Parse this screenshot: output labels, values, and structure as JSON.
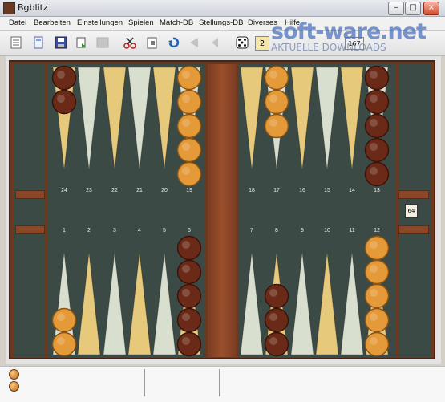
{
  "window": {
    "title": "Bgblitz"
  },
  "menu": [
    "Datei",
    "Bearbeiten",
    "Einstellungen",
    "Spielen",
    "Match-DB",
    "Stellungs-DB",
    "Diverses",
    "Hilfe"
  ],
  "toolbar": {
    "score_label": "2",
    "counter_label": "167"
  },
  "watermark": {
    "brand": "soft-ware.net",
    "tagline": "AKTUELLE DOWNLOADS"
  },
  "board": {
    "top_points": [
      "24",
      "23",
      "22",
      "21",
      "20",
      "19",
      "18",
      "17",
      "16",
      "15",
      "14",
      "13"
    ],
    "bottom_points": [
      "1",
      "2",
      "3",
      "4",
      "5",
      "6",
      "7",
      "8",
      "9",
      "10",
      "11",
      "12"
    ],
    "doubling_cube": "64",
    "colors": {
      "felt": "#3b4a45",
      "frame": "#6b3820",
      "light_point": "#d8dfcf",
      "gold_point": "#e7c97c",
      "dark_checker": "#6a2a17",
      "light_checker": "#e59a3a"
    },
    "checkers": [
      {
        "point": 24,
        "color": "dark",
        "count": 2
      },
      {
        "point": 19,
        "color": "light",
        "count": 5
      },
      {
        "point": 17,
        "color": "light",
        "count": 3
      },
      {
        "point": 13,
        "color": "dark",
        "count": 5
      },
      {
        "point": 1,
        "color": "light",
        "count": 2
      },
      {
        "point": 6,
        "color": "dark",
        "count": 5
      },
      {
        "point": 8,
        "color": "dark",
        "count": 3
      },
      {
        "point": 12,
        "color": "light",
        "count": 5
      }
    ]
  },
  "status": {
    "checkers": 2
  }
}
